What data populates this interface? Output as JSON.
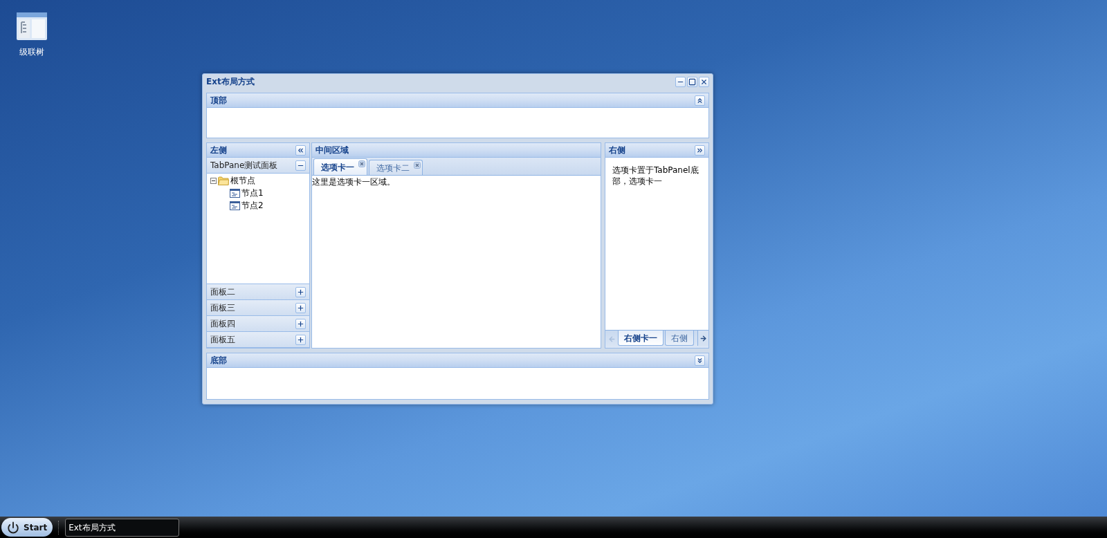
{
  "desktop_icons": [
    {
      "label": "级联树"
    }
  ],
  "window": {
    "title": "Ext布局方式"
  },
  "top_panel": {
    "title": "顶部",
    "collapsed": false
  },
  "left_panel": {
    "title": "左侧",
    "accordion": [
      {
        "title": "TabPane测试面板",
        "expanded": true,
        "tree": [
          {
            "label": "根节点",
            "kind": "folder",
            "expanded": true,
            "children": [
              {
                "label": "节点1",
                "kind": "leaf"
              },
              {
                "label": "节点2",
                "kind": "leaf"
              }
            ]
          }
        ]
      },
      {
        "title": "面板二",
        "expanded": false
      },
      {
        "title": "面板三",
        "expanded": false
      },
      {
        "title": "面板四",
        "expanded": false
      },
      {
        "title": "面板五",
        "expanded": false
      }
    ]
  },
  "center_panel": {
    "title": "中间区域",
    "tabs": [
      {
        "label": "选项卡一",
        "selected": true
      },
      {
        "label": "选项卡二",
        "selected": false
      }
    ],
    "content": "这里是选项卡一区域。"
  },
  "right_panel": {
    "title": "右侧",
    "content": "选项卡置于TabPanel底部，选项卡一",
    "tabs": [
      {
        "label": "右侧卡一",
        "selected": true
      },
      {
        "label": "右侧",
        "selected": false
      }
    ]
  },
  "bottom_panel": {
    "title": "底部",
    "collapsed": false
  },
  "taskbar": {
    "start": "Start",
    "tasks": [
      {
        "label": "Ext布局方式",
        "selected": true
      }
    ]
  }
}
